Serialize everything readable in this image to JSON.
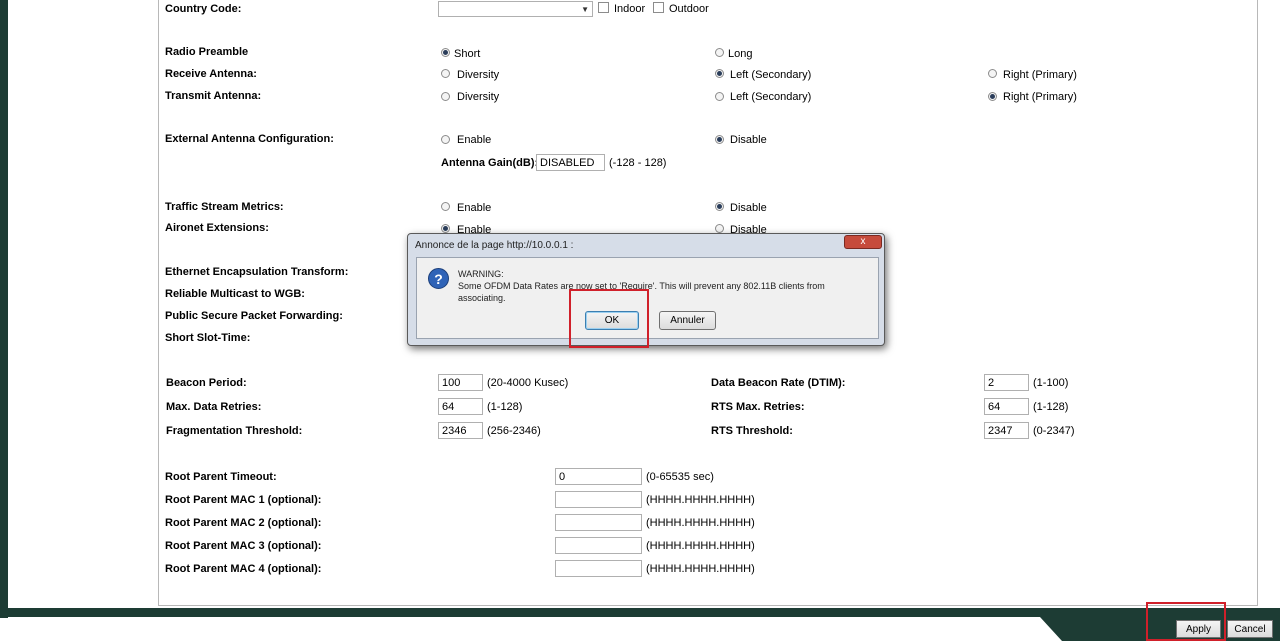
{
  "country_code": {
    "label": "Country Code:",
    "indoor": "Indoor",
    "outdoor": "Outdoor"
  },
  "radio_preamble": {
    "label": "Radio Preamble",
    "short": "Short",
    "long": "Long"
  },
  "receive_antenna": {
    "label": "Receive Antenna:",
    "diversity": "Diversity",
    "left": "Left (Secondary)",
    "right": "Right (Primary)"
  },
  "transmit_antenna": {
    "label": "Transmit Antenna:",
    "diversity": "Diversity",
    "left": "Left (Secondary)",
    "right": "Right (Primary)"
  },
  "external_antenna": {
    "label": "External Antenna Configuration:",
    "enable": "Enable",
    "disable": "Disable",
    "gain_label": "Antenna Gain(dB):",
    "gain_value": "DISABLED",
    "gain_range": "(-128 - 128)"
  },
  "traffic_stream": {
    "label": "Traffic Stream Metrics:",
    "enable": "Enable",
    "disable": "Disable"
  },
  "aironet": {
    "label": "Aironet Extensions:",
    "enable": "Enable",
    "disable": "Disable"
  },
  "ethernet_encap": {
    "label": "Ethernet Encapsulation Transform:"
  },
  "reliable_multicast": {
    "label": "Reliable Multicast to WGB:"
  },
  "public_secure": {
    "label": "Public Secure Packet Forwarding:"
  },
  "short_slot": {
    "label": "Short Slot-Time:"
  },
  "beacon_period": {
    "label": "Beacon Period:",
    "value": "100",
    "range": "(20-4000 Kusec)"
  },
  "data_beacon_rate": {
    "label": "Data Beacon Rate (DTIM):",
    "value": "2",
    "range": "(1-100)"
  },
  "max_data_retries": {
    "label": "Max. Data Retries:",
    "value": "64",
    "range": "(1-128)"
  },
  "rts_max_retries": {
    "label": "RTS Max. Retries:",
    "value": "64",
    "range": "(1-128)"
  },
  "frag_threshold": {
    "label": "Fragmentation Threshold:",
    "value": "2346",
    "range": "(256-2346)"
  },
  "rts_threshold": {
    "label": "RTS Threshold:",
    "value": "2347",
    "range": "(0-2347)"
  },
  "root_parent_timeout": {
    "label": "Root Parent Timeout:",
    "value": "0",
    "range": "(0-65535 sec)"
  },
  "root_parent_mac": [
    {
      "label": "Root Parent MAC 1 (optional):",
      "value": "",
      "format": "(HHHH.HHHH.HHHH)"
    },
    {
      "label": "Root Parent MAC 2 (optional):",
      "value": "",
      "format": "(HHHH.HHHH.HHHH)"
    },
    {
      "label": "Root Parent MAC 3 (optional):",
      "value": "",
      "format": "(HHHH.HHHH.HHHH)"
    },
    {
      "label": "Root Parent MAC 4 (optional):",
      "value": "",
      "format": "(HHHH.HHHH.HHHH)"
    }
  ],
  "footer": {
    "apply": "Apply",
    "cancel": "Cancel"
  },
  "dialog": {
    "title": "Annonce de la page http://10.0.0.1 :",
    "close": "x",
    "icon": "?",
    "line1": "WARNING:",
    "line2": "Some OFDM Data Rates are now set to 'Require'.  This will prevent any 802.11B clients from",
    "line3": "associating.",
    "ok": "OK",
    "cancel": "Annuler"
  },
  "colors": {
    "frame": "#1d3c34",
    "highlight": "#d0202a",
    "dialog_title_bg": "#d6dde8",
    "close_button": "#c64b3c"
  }
}
